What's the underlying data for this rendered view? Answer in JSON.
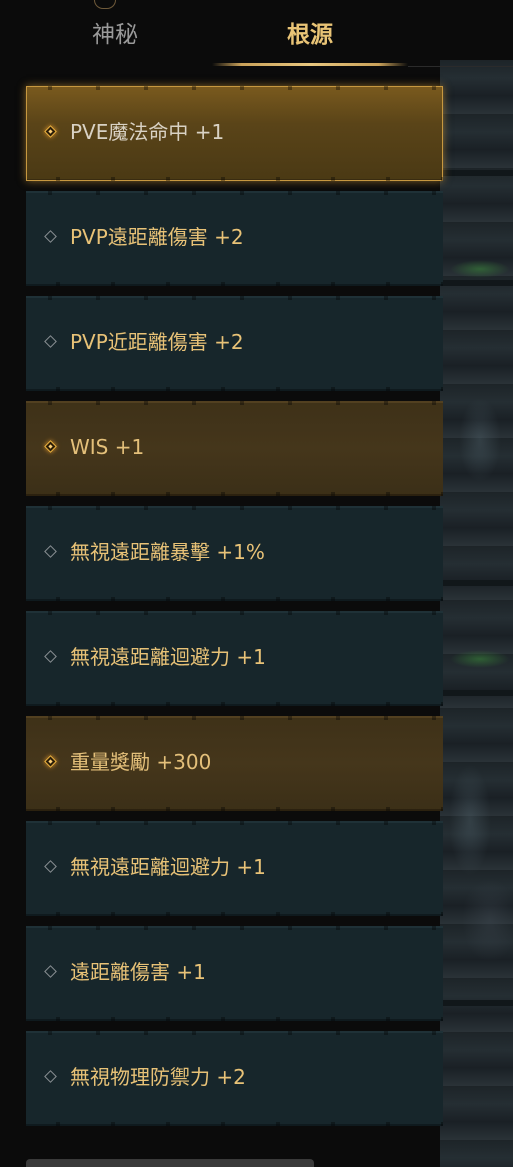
{
  "tabs": {
    "mystic_label": "神秘",
    "origin_label": "根源",
    "active": "根源"
  },
  "items": [
    {
      "label": "PVE魔法命中 +1",
      "style": "gold-bright",
      "marker": "diamond-active-icon"
    },
    {
      "label": "PVP遠距離傷害 +2",
      "style": "normal",
      "marker": "diamond-icon"
    },
    {
      "label": "PVP近距離傷害 +2",
      "style": "normal",
      "marker": "diamond-icon"
    },
    {
      "label": "WIS +1",
      "style": "gold",
      "marker": "diamond-active-icon"
    },
    {
      "label": "無視遠距離暴擊 +1%",
      "style": "normal",
      "marker": "diamond-icon"
    },
    {
      "label": "無視遠距離迴避力 +1",
      "style": "normal",
      "marker": "diamond-icon"
    },
    {
      "label": "重量獎勵 +300",
      "style": "gold",
      "marker": "diamond-active-icon"
    },
    {
      "label": "無視遠距離迴避力 +1",
      "style": "normal",
      "marker": "diamond-icon"
    },
    {
      "label": "遠距離傷害 +1",
      "style": "normal",
      "marker": "diamond-icon"
    },
    {
      "label": "無視物理防禦力 +2",
      "style": "normal",
      "marker": "diamond-icon"
    }
  ],
  "colors": {
    "accent_gold": "#e9c476",
    "item_teal": "#17262b",
    "item_gold": "#45361b"
  }
}
